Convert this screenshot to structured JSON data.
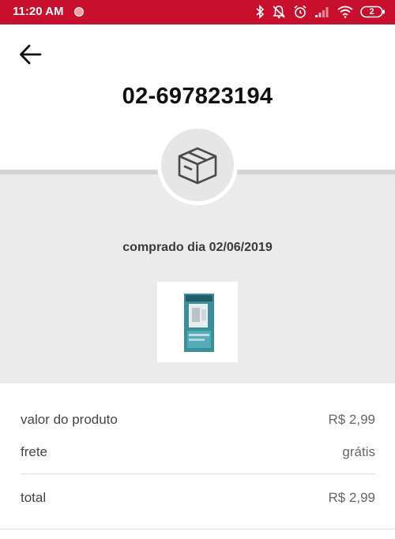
{
  "status_bar": {
    "time": "11:20 AM",
    "battery_level": "2",
    "icons": [
      "bluetooth-icon",
      "notifications-off-icon",
      "alarm-icon",
      "signal-icon",
      "wifi-icon",
      "battery-icon"
    ]
  },
  "header": {
    "back_icon": "arrow-left-icon",
    "order_number": "02-697823194"
  },
  "order": {
    "status_icon": "package-box-icon",
    "purchased_text": "comprado dia 02/06/2019",
    "product_image": "product-thumbnail"
  },
  "summary": {
    "rows": [
      {
        "label": "valor do produto",
        "value": "R$ 2,99"
      },
      {
        "label": "frete",
        "value": "grátis"
      },
      {
        "label": "total",
        "value": "R$ 2,99"
      }
    ]
  },
  "colors": {
    "status_bar": "#c8102e",
    "panel_gray": "#ebebeb",
    "divider_gray": "#d4d4d4",
    "text_dark": "#111111"
  }
}
